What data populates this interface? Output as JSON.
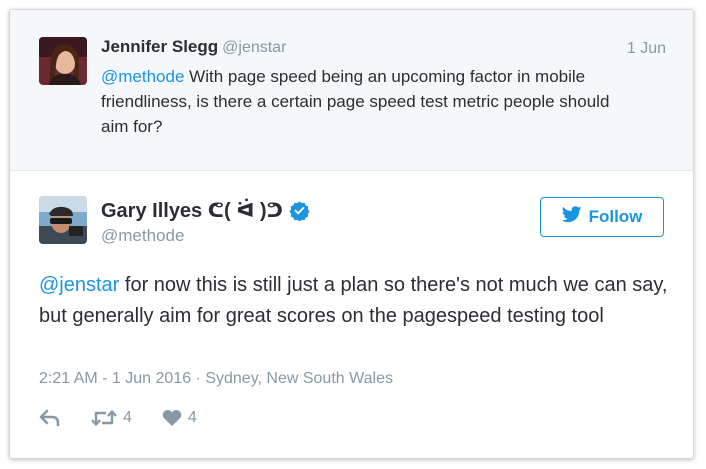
{
  "parent_tweet": {
    "name": "Jennifer Slegg",
    "handle": "@jenstar",
    "date": "1 Jun",
    "mention": "@methode",
    "text": " With page speed being an upcoming factor in mobile friendliness, is there a certain page speed test metric people should aim for?"
  },
  "tweet": {
    "name": "Gary Illyes ᕦ( ᐛ )ᕤ",
    "handle": "@methode",
    "follow_label": "Follow",
    "mention": "@jenstar",
    "text": " for now this is still just a plan so there's not much we can say, but generally aim for great scores on the pagespeed testing tool",
    "timestamp": "2:21 AM - 1 Jun 2016 · Sydney, New South Wales",
    "retweets": "4",
    "likes": "4"
  },
  "colors": {
    "accent": "#1b95e0",
    "muted": "#8899a6",
    "text": "#292f33",
    "context_bg": "#f5f8fa"
  },
  "icons": {
    "reply": "reply-icon",
    "retweet": "retweet-icon",
    "like": "heart-icon",
    "verified": "verified-badge-icon",
    "follow": "twitter-bird-icon"
  }
}
